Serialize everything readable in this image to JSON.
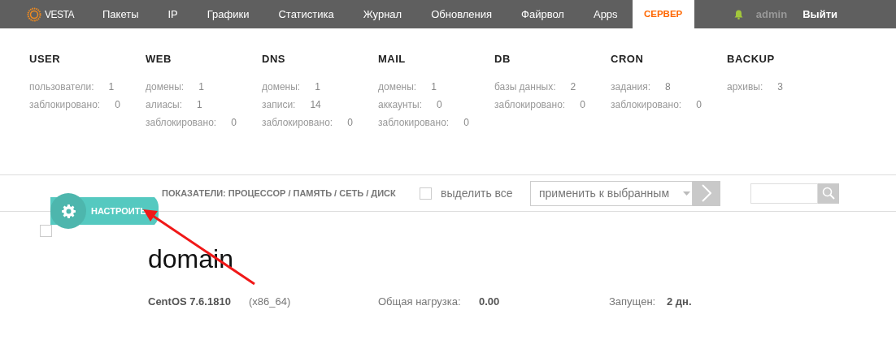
{
  "navbar": {
    "logo": "VESTA",
    "items": [
      {
        "label": "Пакеты",
        "selected": false
      },
      {
        "label": "IP",
        "selected": false
      },
      {
        "label": "Графики",
        "selected": false
      },
      {
        "label": "Статистика",
        "selected": false
      },
      {
        "label": "Журнал",
        "selected": false
      },
      {
        "label": "Обновления",
        "selected": false
      },
      {
        "label": "Файрвол",
        "selected": false
      },
      {
        "label": "Apps",
        "selected": false
      },
      {
        "label": "СЕРВЕР",
        "selected": true
      }
    ],
    "user": "admin",
    "logout": "Выйти"
  },
  "stats": [
    {
      "title": "USER",
      "rows": [
        {
          "label": "пользователи:",
          "value": "1"
        },
        {
          "label": "заблокировано:",
          "value": "0"
        }
      ]
    },
    {
      "title": "WEB",
      "rows": [
        {
          "label": "домены:",
          "value": "1"
        },
        {
          "label": "алиасы:",
          "value": "1"
        },
        {
          "label": "заблокировано:",
          "value": "0"
        }
      ]
    },
    {
      "title": "DNS",
      "rows": [
        {
          "label": "домены:",
          "value": "1"
        },
        {
          "label": "записи:",
          "value": "14"
        },
        {
          "label": "заблокировано:",
          "value": "0"
        }
      ]
    },
    {
      "title": "MAIL",
      "rows": [
        {
          "label": "домены:",
          "value": "1"
        },
        {
          "label": "аккаунты:",
          "value": "0"
        },
        {
          "label": "заблокировано:",
          "value": "0"
        }
      ]
    },
    {
      "title": "DB",
      "rows": [
        {
          "label": "базы данных:",
          "value": "2"
        },
        {
          "label": "заблокировано:",
          "value": "0"
        }
      ]
    },
    {
      "title": "CRON",
      "rows": [
        {
          "label": "задания:",
          "value": "8"
        },
        {
          "label": "заблокировано:",
          "value": "0"
        }
      ]
    },
    {
      "title": "BACKUP",
      "rows": [
        {
          "label": "архивы:",
          "value": "3"
        }
      ]
    }
  ],
  "toolbar": {
    "indicators": "ПОКАЗАТЕЛИ: ПРОЦЕССОР / ПАМЯТЬ / СЕТЬ / ДИСК",
    "select_all": {
      "label": "выделить все",
      "checked": false
    },
    "bulk_action": {
      "value": "применить к выбранным"
    }
  },
  "settings_button": {
    "label": "НАСТРОИТЬ"
  },
  "server": {
    "checked": false,
    "name": "domain",
    "os": "CentOS 7.6.1810",
    "arch": "(x86_64)",
    "load_label": "Общая нагрузка:",
    "load_value": "0.00",
    "uptime_label": "Запущен:",
    "uptime_value": "2 дн."
  },
  "annotations": [
    {
      "kind": "arrow"
    }
  ]
}
